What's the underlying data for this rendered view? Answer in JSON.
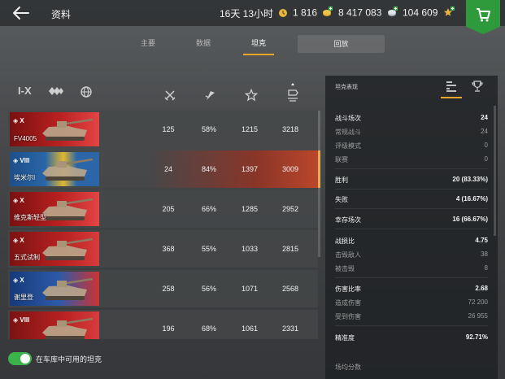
{
  "header": {
    "title": "资料",
    "premium_time": "16天 13小时",
    "gold": "1 816",
    "credits": "8 417 083",
    "free_xp": "104 609"
  },
  "tabs": [
    {
      "label": "主要",
      "active": false
    },
    {
      "label": "数据",
      "active": false
    },
    {
      "label": "坦克",
      "active": true
    },
    {
      "label": "回放",
      "active": false
    }
  ],
  "filters": {
    "tier": "I-X"
  },
  "columns": [
    "battles-icon",
    "win-rate-icon",
    "mastery-icon",
    "avg-damage-icon"
  ],
  "tanks": [
    {
      "name": "FV4005",
      "tier": "X",
      "flag": "uk",
      "battles": "125",
      "winrate": "58%",
      "mastery": "1215",
      "damage": "3218",
      "selected": false
    },
    {
      "name": "埃米尔I",
      "tier": "VIII",
      "flag": "sweden",
      "battles": "24",
      "winrate": "84%",
      "mastery": "1397",
      "damage": "3009",
      "selected": true
    },
    {
      "name": "维克斯轻型",
      "tier": "X",
      "flag": "uk",
      "battles": "205",
      "winrate": "66%",
      "mastery": "1285",
      "damage": "2952",
      "selected": false
    },
    {
      "name": "五式试制",
      "tier": "X",
      "flag": "japan",
      "battles": "368",
      "winrate": "55%",
      "mastery": "1033",
      "damage": "2815",
      "selected": false
    },
    {
      "name": "谢里登",
      "tier": "X",
      "flag": "usa",
      "battles": "258",
      "winrate": "56%",
      "mastery": "1071",
      "damage": "2568",
      "selected": false
    },
    {
      "name": "",
      "tier": "VIII",
      "flag": "japan",
      "battles": "196",
      "winrate": "68%",
      "mastery": "1061",
      "damage": "2331",
      "selected": false
    }
  ],
  "toggle": {
    "label": "在车库中可用的坦克",
    "on": true
  },
  "panel": {
    "title": "坦克表现",
    "stats": [
      {
        "label": "战斗场次",
        "value": "24",
        "kind": "main"
      },
      {
        "label": "常规战斗",
        "value": "24",
        "kind": "sub"
      },
      {
        "label": "评级模式",
        "value": "0",
        "kind": "sub"
      },
      {
        "label": "联赛",
        "value": "0",
        "kind": "sub"
      },
      {
        "label": "胜利",
        "value": "20 (83.33%)",
        "kind": "main"
      },
      {
        "label": "失败",
        "value": "4 (16.67%)",
        "kind": "main"
      },
      {
        "label": "幸存场次",
        "value": "16 (66.67%)",
        "kind": "main"
      },
      {
        "label": "战损比",
        "value": "4.75",
        "kind": "main"
      },
      {
        "label": "击毁敌人",
        "value": "38",
        "kind": "sub"
      },
      {
        "label": "被击毁",
        "value": "8",
        "kind": "sub"
      },
      {
        "label": "伤害比率",
        "value": "2.68",
        "kind": "main"
      },
      {
        "label": "造成伤害",
        "value": "72 200",
        "kind": "sub"
      },
      {
        "label": "受到伤害",
        "value": "26 955",
        "kind": "sub"
      },
      {
        "label": "精准度",
        "value": "92.71%",
        "kind": "main"
      },
      {
        "label": "场均分数",
        "value": "",
        "kind": "sub"
      }
    ]
  },
  "colors": {
    "accent": "#f0a52a",
    "shop": "#2f9a3c",
    "toggle": "#3bb34a"
  }
}
